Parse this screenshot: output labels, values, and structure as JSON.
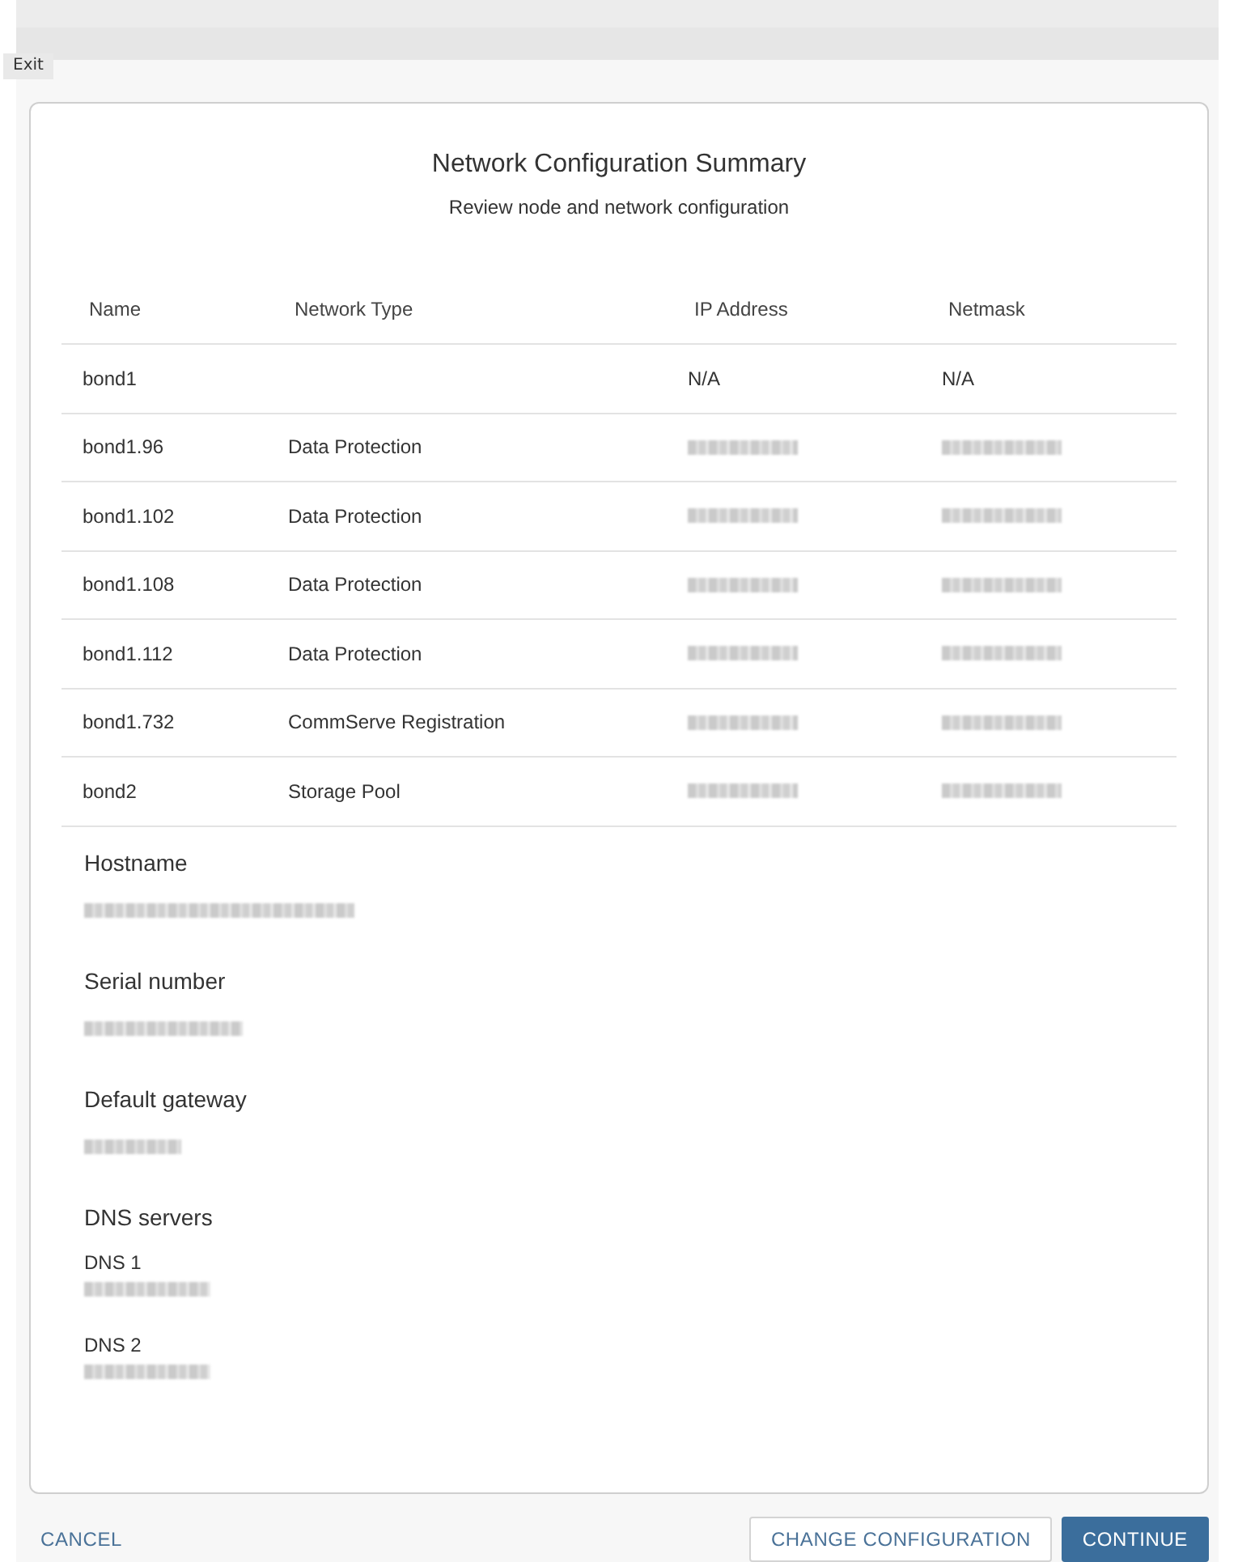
{
  "top_bar": {
    "exit_button": "Exit"
  },
  "dialog": {
    "title": "Network Configuration Summary",
    "subtitle": "Review node and network configuration",
    "table": {
      "columns": [
        "Name",
        "Network Type",
        "IP Address",
        "Netmask"
      ],
      "rows": [
        {
          "name": "bond1",
          "ip_address": {
            "kind": "text",
            "text": "N/A"
          },
          "netmask": {
            "kind": "text",
            "text": "N/A"
          }
        },
        {
          "name": "bond1.96",
          "network_type": "Data Protection",
          "ip_address": {
            "kind": "blurred"
          },
          "netmask": {
            "kind": "blurred"
          }
        },
        {
          "name": "bond1.102",
          "network_type": "Data Protection",
          "ip_address": {
            "kind": "blurred"
          },
          "netmask": {
            "kind": "blurred"
          }
        },
        {
          "name": "bond1.108",
          "network_type": "Data Protection",
          "ip_address": {
            "kind": "blurred"
          },
          "netmask": {
            "kind": "blurred"
          }
        },
        {
          "name": "bond1.112",
          "network_type": "Data Protection",
          "ip_address": {
            "kind": "blurred"
          },
          "netmask": {
            "kind": "blurred"
          }
        },
        {
          "name": "bond1.732",
          "network_type": "CommServe Registration",
          "ip_address": {
            "kind": "blurred"
          },
          "netmask": {
            "kind": "blurred"
          }
        },
        {
          "name": "bond2",
          "network_type": "Storage Pool",
          "ip_address": {
            "kind": "blurred"
          },
          "netmask": {
            "kind": "blurred"
          }
        }
      ]
    },
    "details": [
      {
        "label": "Hostname",
        "value": {
          "kind": "blurred"
        }
      },
      {
        "label": "Serial number",
        "value": {
          "kind": "blurred"
        }
      },
      {
        "label": "Default gateway",
        "value": {
          "kind": "blurred"
        }
      }
    ],
    "dns": {
      "label": "DNS servers",
      "entries": [
        {
          "label": "DNS 1",
          "value": {
            "kind": "blurred"
          }
        },
        {
          "label": "DNS 2",
          "value": {
            "kind": "blurred"
          }
        }
      ]
    }
  },
  "footer": {
    "cancel_button": "CANCEL",
    "change_button": "CHANGE CONFIGURATION",
    "continue_button": "CONTINUE"
  }
}
